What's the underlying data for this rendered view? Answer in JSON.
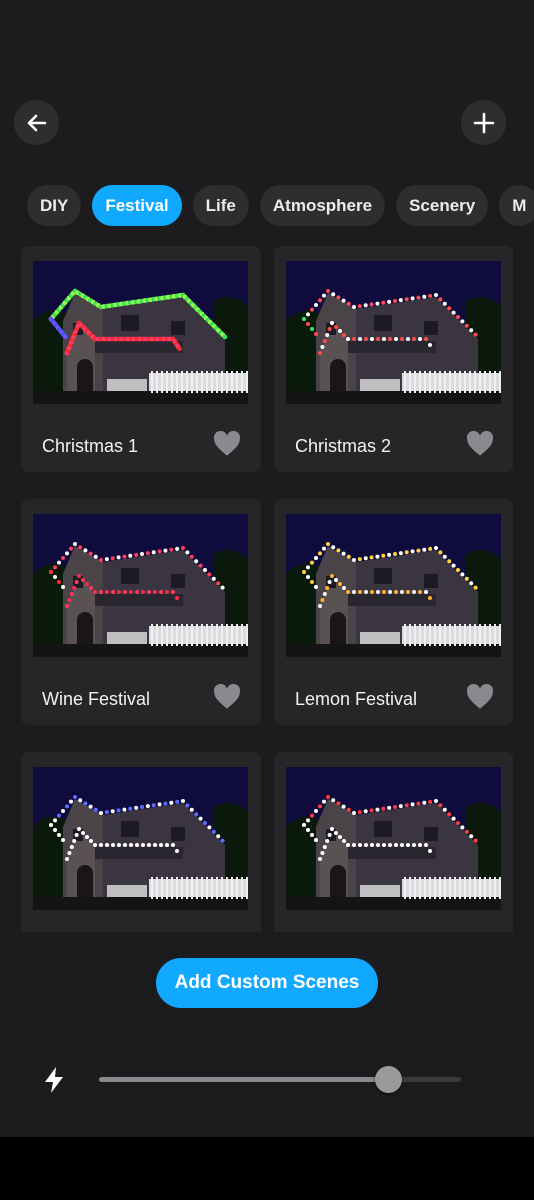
{
  "nav": {
    "back_icon": "arrow-left-icon",
    "add_icon": "plus-icon"
  },
  "tabs": [
    {
      "label": "DIY",
      "active": false
    },
    {
      "label": "Festival",
      "active": true
    },
    {
      "label": "Life",
      "active": false
    },
    {
      "label": "Atmosphere",
      "active": false
    },
    {
      "label": "Scenery",
      "active": false
    },
    {
      "label": "M",
      "active": false
    }
  ],
  "scenes": [
    {
      "name": "Christmas 1",
      "favorite": false
    },
    {
      "name": "Christmas 2",
      "favorite": false
    },
    {
      "name": "Wine Festival",
      "favorite": false
    },
    {
      "name": "Lemon Festival",
      "favorite": false
    },
    {
      "name": "",
      "favorite": false
    },
    {
      "name": "",
      "favorite": false
    }
  ],
  "actions": {
    "add_custom_label": "Add Custom Scenes"
  },
  "brightness": {
    "icon": "lightning-icon",
    "level": 0.8
  },
  "colors": {
    "accent": "#10a9ff",
    "background": "#1c1c1e",
    "card": "#262628"
  }
}
